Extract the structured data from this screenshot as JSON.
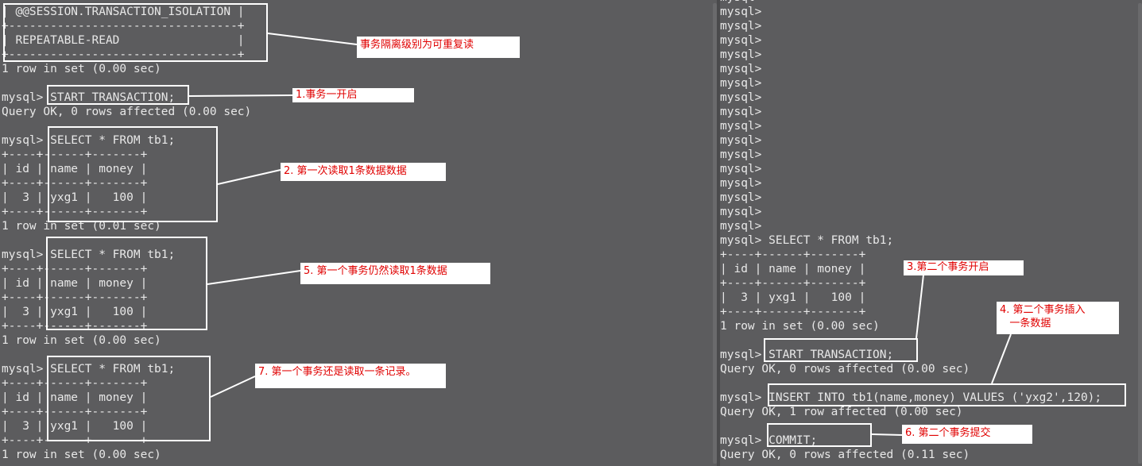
{
  "left_terminal": {
    "lines": [
      "| @@SESSION.TRANSACTION_ISOLATION |",
      "+---------------------------------+",
      "| REPEATABLE-READ                 |",
      "+---------------------------------+",
      "1 row in set (0.00 sec)",
      "",
      "mysql> START TRANSACTION;",
      "Query OK, 0 rows affected (0.00 sec)",
      "",
      "mysql> SELECT * FROM tb1;",
      "+----+------+-------+",
      "| id | name | money |",
      "+----+------+-------+",
      "|  3 | yxg1 |   100 |",
      "+----+------+-------+",
      "1 row in set (0.01 sec)",
      "",
      "mysql> SELECT * FROM tb1;",
      "+----+------+-------+",
      "| id | name | money |",
      "+----+------+-------+",
      "|  3 | yxg1 |   100 |",
      "+----+------+-------+",
      "1 row in set (0.00 sec)",
      "",
      "mysql> SELECT * FROM tb1;",
      "+----+------+-------+",
      "| id | name | money |",
      "+----+------+-------+",
      "|  3 | yxg1 |   100 |",
      "+----+------+-------+",
      "1 row in set (0.00 sec)"
    ]
  },
  "right_terminal": {
    "lines": [
      "mysql>",
      "mysql>",
      "mysql>",
      "mysql>",
      "mysql>",
      "mysql>",
      "mysql>",
      "mysql>",
      "mysql>",
      "mysql>",
      "mysql>",
      "mysql>",
      "mysql>",
      "mysql>",
      "mysql>",
      "mysql>",
      "mysql>",
      "mysql> SELECT * FROM tb1;",
      "+----+------+-------+",
      "| id | name | money |",
      "+----+------+-------+",
      "|  3 | yxg1 |   100 |",
      "+----+------+-------+",
      "1 row in set (0.00 sec)",
      "",
      "mysql> START TRANSACTION;",
      "Query OK, 0 rows affected (0.00 sec)",
      "",
      "mysql> INSERT INTO tb1(name,money) VALUES ('yxg2',120);",
      "Query OK, 1 row affected (0.00 sec)",
      "",
      "mysql> COMMIT;",
      "Query OK, 0 rows affected (0.11 sec)"
    ]
  },
  "annotations": {
    "isolation": "事务隔离级别为可重复读",
    "step1": "1.事务一开启",
    "step2": "2. 第一次读取1条数据数据",
    "step5": "5. 第一个事务仍然读取1条数据",
    "step7": "7. 第一个事务还是读取一条记录。",
    "step3": "3.第二个事务开启",
    "step4": "4. 第二个事务插入\n   一条数据",
    "step6": "6. 第二个事务提交"
  },
  "colors": {
    "terminal_bg": "#5c5c5e",
    "terminal_text": "#e8e8e8",
    "annotation_text": "#e00000",
    "annotation_bg": "#ffffff"
  }
}
